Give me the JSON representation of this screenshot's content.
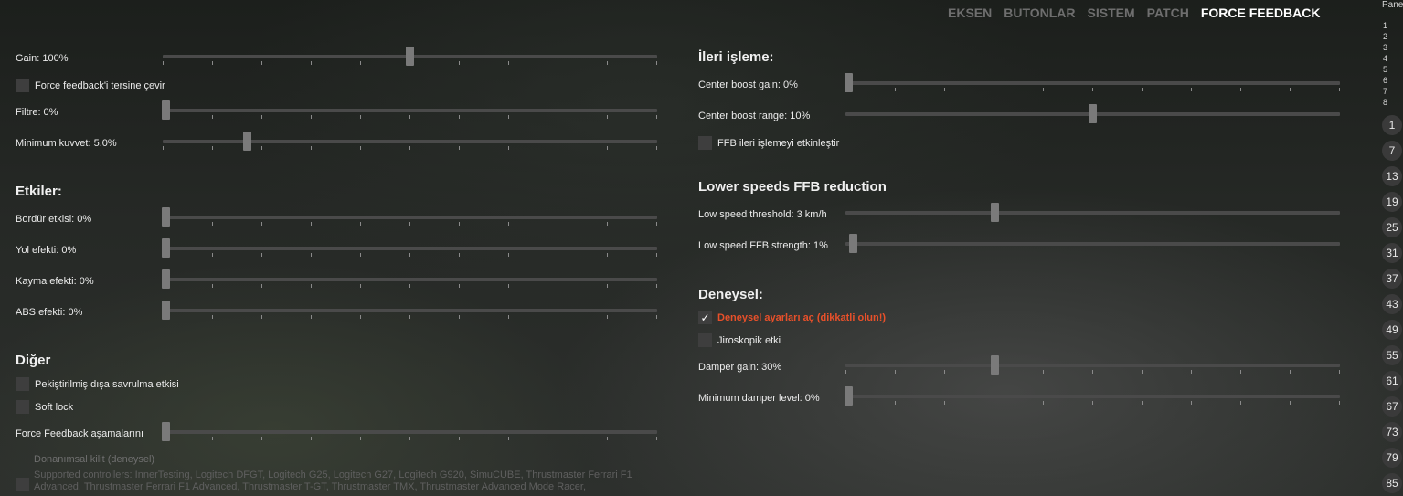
{
  "tabs": [
    {
      "label": "EKSEN",
      "active": false
    },
    {
      "label": "BUTONLAR",
      "active": false
    },
    {
      "label": "SISTEM",
      "active": false
    },
    {
      "label": "PATCH",
      "active": false
    },
    {
      "label": "FORCE FEEDBACK",
      "active": true
    }
  ],
  "left": {
    "gain_label": "Gain: 100%",
    "gain_value": 0.5,
    "invert_label": "Force feedback'i tersine çevir",
    "filter_label": "Filtre: 0%",
    "filter_value": 0,
    "min_force_label": "Minimum kuvvet: 5.0%",
    "min_force_value": 0.167,
    "effects_heading": "Etkiler:",
    "kerb_label": "Bordür etkisi: 0%",
    "kerb_value": 0,
    "road_label": "Yol efekti: 0%",
    "road_value": 0,
    "slip_label": "Kayma efekti: 0%",
    "slip_value": 0,
    "abs_label": "ABS efekti: 0%",
    "abs_value": 0,
    "other_heading": "Diğer",
    "enhanced_understeer_label": "Pekiştirilmiş dışa savrulma etkisi",
    "soft_lock_label": "Soft lock",
    "ffb_steps_label": "Force Feedback aşamalarını a",
    "ffb_steps_value": 0,
    "hardware_lock_label": "Donanımsal kilit (deneysel)",
    "supported_note": "Supported controllers: InnerTesting, Logitech DFGT, Logitech G25, Logitech G27, Logitech G920, SimuCUBE, Thrustmaster Ferrari F1 Advanced, Thrustmaster Ferrari F1 Advanced, Thrustmaster T-GT, Thrustmaster TMX, Thrustmaster Advanced Mode Racer,"
  },
  "right": {
    "postprocess_heading": "İleri işleme:",
    "center_boost_gain_label": "Center boost gain: 0%",
    "center_boost_gain_value": 0,
    "center_boost_range_label": "Center boost range: 10%",
    "center_boost_range_value": 0.5,
    "enable_postprocess_label": "FFB ileri işlemeyi etkinleştir",
    "lowspeed_heading": "Lower speeds FFB reduction",
    "lowspeed_threshold_label": "Low speed threshold: 3 km/h",
    "lowspeed_threshold_value": 0.3,
    "lowspeed_strength_label": "Low speed FFB strength: 1%",
    "lowspeed_strength_value": 0.01,
    "experimental_heading": "Deneysel:",
    "experimental_enable_label": "Deneysel ayarları aç (dikkatli olun!)",
    "experimental_enable_checked": true,
    "gyro_label": "Jiroskopik etki",
    "damper_gain_label": "Damper gain: 30%",
    "damper_gain_value": 0.3,
    "min_damper_label": "Minimum damper level: 0%",
    "min_damper_value": 0
  },
  "panel": {
    "title": "Pane",
    "numbers": [
      "1",
      "2",
      "3",
      "4",
      "5",
      "6",
      "7",
      "8"
    ],
    "circles": [
      "1",
      "7",
      "13",
      "19",
      "25",
      "31",
      "37",
      "43",
      "49",
      "55",
      "61",
      "67",
      "73",
      "79",
      "85"
    ]
  },
  "colors": {
    "accent_warning": "#e8502a",
    "track": "#4a4a4a",
    "thumb": "#7a7a7a"
  }
}
